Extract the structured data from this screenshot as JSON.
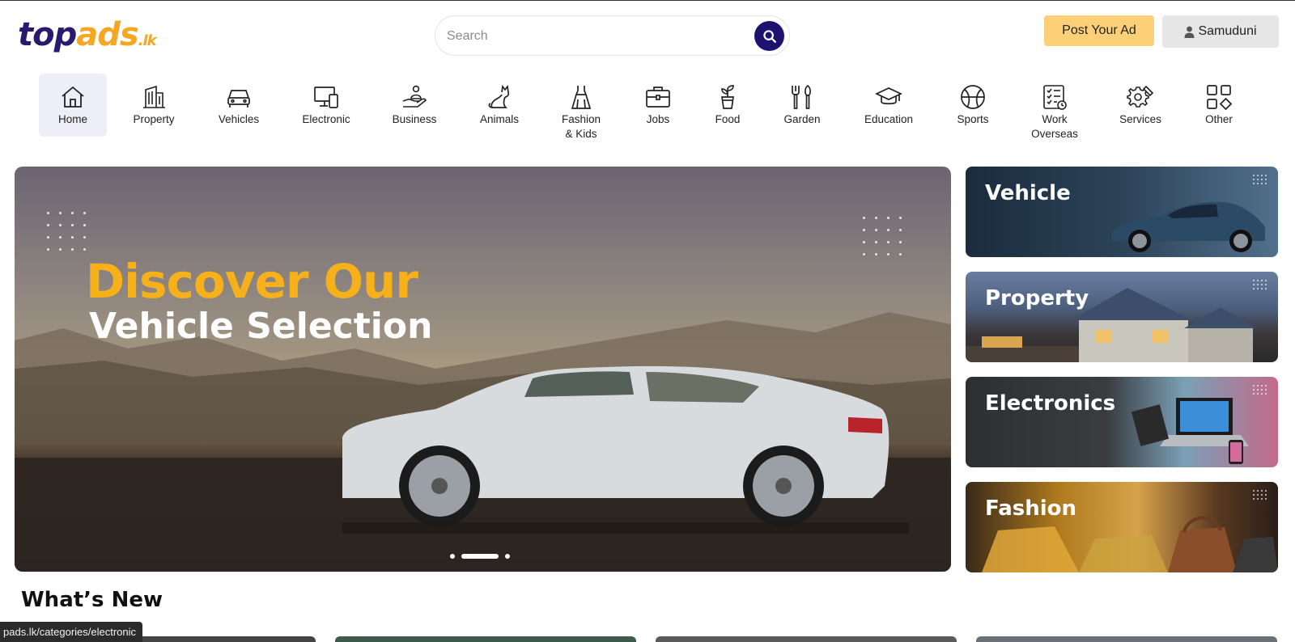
{
  "header": {
    "logo": {
      "part1": "top",
      "part2": "ads",
      "part3": ".lk"
    },
    "search": {
      "placeholder": "Search"
    },
    "post_ad_label": "Post Your Ad",
    "user_label": "Samuduni"
  },
  "categories": [
    {
      "label": "Home",
      "icon": "home-icon",
      "active": true
    },
    {
      "label": "Property",
      "icon": "building-icon"
    },
    {
      "label": "Vehicles",
      "icon": "car-icon"
    },
    {
      "label": "Electronic",
      "icon": "devices-icon"
    },
    {
      "label": "Business",
      "icon": "hand-person-icon"
    },
    {
      "label": "Animals",
      "icon": "cat-icon"
    },
    {
      "label": "Fashion",
      "label2": "& Kids",
      "icon": "dress-icon"
    },
    {
      "label": "Jobs",
      "icon": "briefcase-icon"
    },
    {
      "label": "Food",
      "icon": "plant-pot-icon"
    },
    {
      "label": "Garden",
      "icon": "garden-tools-icon"
    },
    {
      "label": "Education",
      "icon": "graduation-cap-icon"
    },
    {
      "label": "Sports",
      "icon": "basketball-icon"
    },
    {
      "label": "Work",
      "label2": "Overseas",
      "icon": "checklist-icon"
    },
    {
      "label": "Services",
      "icon": "gear-wrench-icon"
    },
    {
      "label": "Other",
      "icon": "grid-shapes-icon"
    }
  ],
  "banner": {
    "title_line1": "Discover Our",
    "title_line2": "Vehicle Selection",
    "accent_color": "#f5b01a",
    "slides": 3,
    "active_slide": 2
  },
  "side_cards": [
    {
      "title": "Vehicle"
    },
    {
      "title": "Property"
    },
    {
      "title": "Electronics"
    },
    {
      "title": "Fashion"
    }
  ],
  "whats_new": {
    "heading": "What’s New"
  },
  "status_bar": {
    "url": "pads.lk/categories/electronic"
  },
  "colors": {
    "brand_dark": "#1e1270",
    "brand_yellow": "#fdd078"
  }
}
